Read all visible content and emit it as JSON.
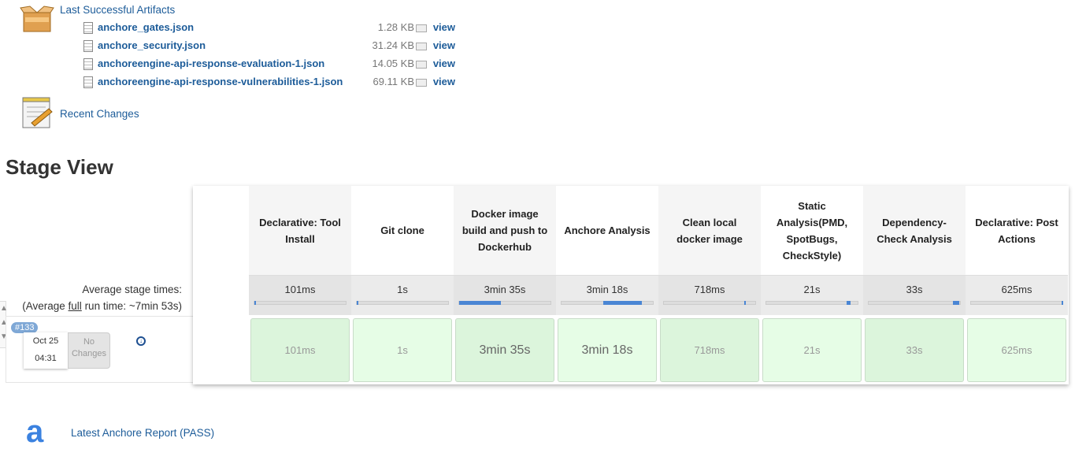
{
  "artifacts": {
    "title": "Last Successful Artifacts",
    "files": [
      {
        "name": "anchore_gates.json",
        "size": "1.28 KB",
        "view": "view"
      },
      {
        "name": "anchore_security.json",
        "size": "31.24 KB",
        "view": "view"
      },
      {
        "name": "anchoreengine-api-response-evaluation-1.json",
        "size": "14.05 KB",
        "view": "view"
      },
      {
        "name": "anchoreengine-api-response-vulnerabilities-1.json",
        "size": "69.11 KB",
        "view": "view"
      }
    ]
  },
  "recent_changes": "Recent Changes",
  "stage_view": {
    "title": "Stage View",
    "avg_label": "Average stage times:",
    "avg_full_prefix": "(Average ",
    "avg_full_link": "full",
    "avg_full_suffix": " run time: ~7min 53s)",
    "stages": [
      {
        "name": "Declarative: Tool Install",
        "avg": "101ms",
        "bar": [
          0,
          0.002
        ],
        "build": "101ms"
      },
      {
        "name": "Git clone",
        "avg": "1s",
        "bar": [
          0,
          0.004
        ],
        "build": "1s"
      },
      {
        "name": "Docker image build and push to Dockerhub",
        "avg": "3min 35s",
        "bar": [
          0,
          0.46
        ],
        "build": "3min 35s"
      },
      {
        "name": "Anchore Analysis",
        "avg": "3min 18s",
        "bar": [
          0.46,
          0.88
        ],
        "build": "3min 18s"
      },
      {
        "name": "Clean local docker image",
        "avg": "718ms",
        "bar": [
          0.88,
          0.89
        ],
        "build": "718ms"
      },
      {
        "name": "Static Analysis(PMD, SpotBugs, CheckStyle)",
        "avg": "21s",
        "bar": [
          0.88,
          0.92
        ],
        "build": "21s"
      },
      {
        "name": "Dependency-Check Analysis",
        "avg": "33s",
        "bar": [
          0.92,
          0.99
        ],
        "build": "33s"
      },
      {
        "name": "Declarative: Post Actions",
        "avg": "625ms",
        "bar": [
          0.99,
          1.0
        ],
        "build": "625ms"
      }
    ],
    "build": {
      "number": "#133",
      "date": "Oct 25",
      "time": "04:31",
      "changes": "No Changes"
    }
  },
  "anchore_report": "Latest Anchore Report (PASS)",
  "colors": {
    "link": "#1d5c99",
    "success_dark": "#dcf5dc",
    "success_light": "#e6fde6",
    "bar": "#4a86d4"
  }
}
